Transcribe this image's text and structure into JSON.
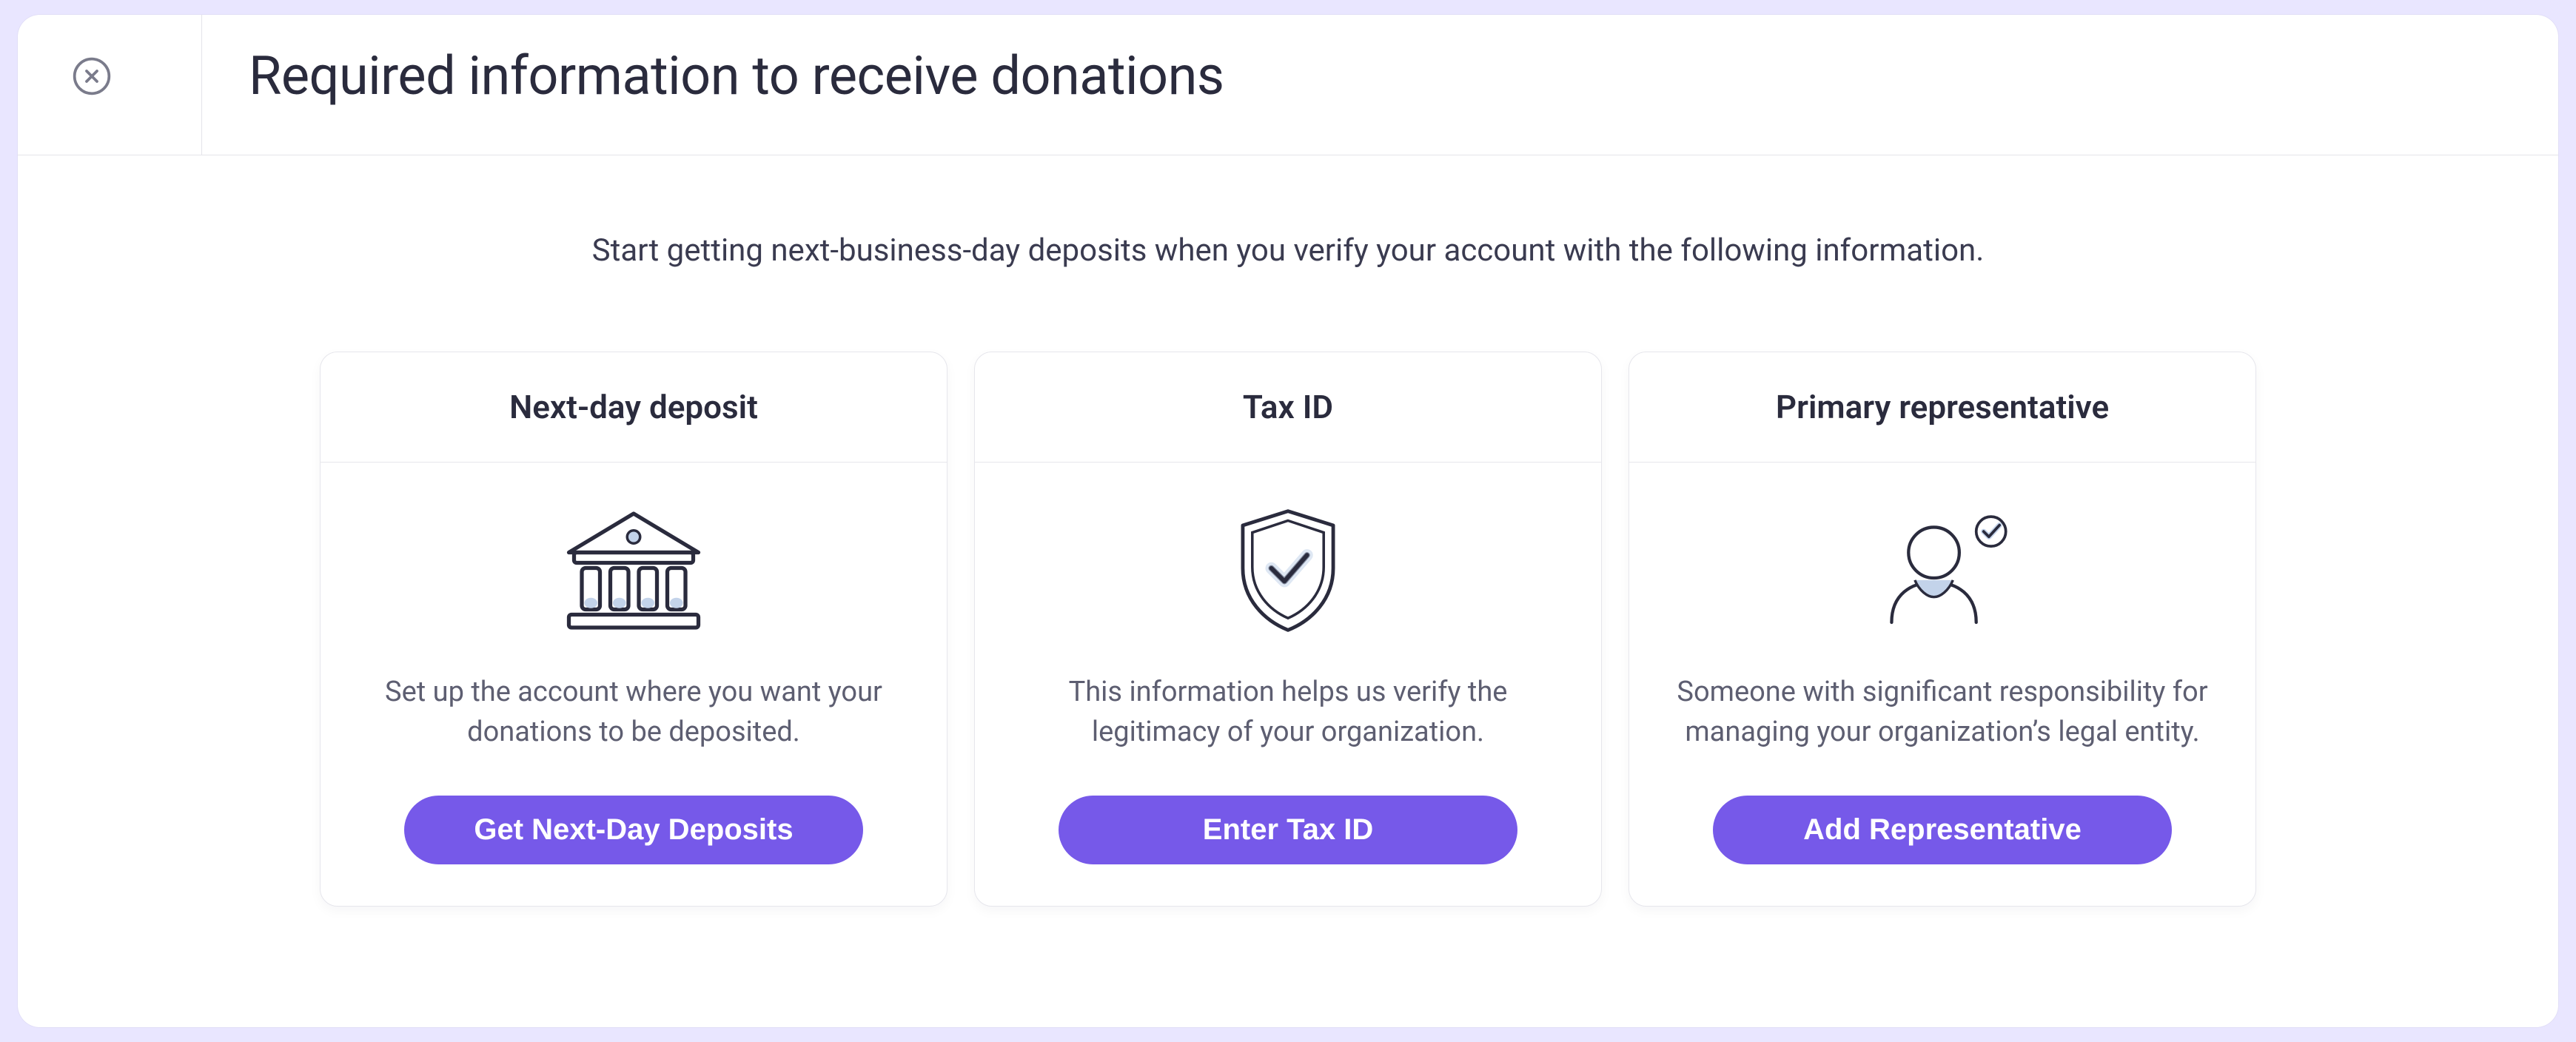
{
  "header": {
    "title": "Required information to receive donations",
    "close_icon": "close"
  },
  "intro": "Start getting next-business-day deposits when you verify your account with the following information.",
  "cards": [
    {
      "title": "Next-day deposit",
      "desc": "Set up the account where you want your donations to be deposited.",
      "cta": "Get Next-Day Deposits",
      "icon": "bank"
    },
    {
      "title": "Tax ID",
      "desc": "This information helps us verify the legitimacy of your organization.",
      "cta": "Enter Tax ID",
      "icon": "shield-check"
    },
    {
      "title": "Primary representative",
      "desc": "Someone with significant responsibility for managing your organization’s legal entity.",
      "cta": "Add Representative",
      "icon": "person-verified"
    }
  ],
  "colors": {
    "accent": "#7659e9",
    "background": "#e9e6ff"
  }
}
